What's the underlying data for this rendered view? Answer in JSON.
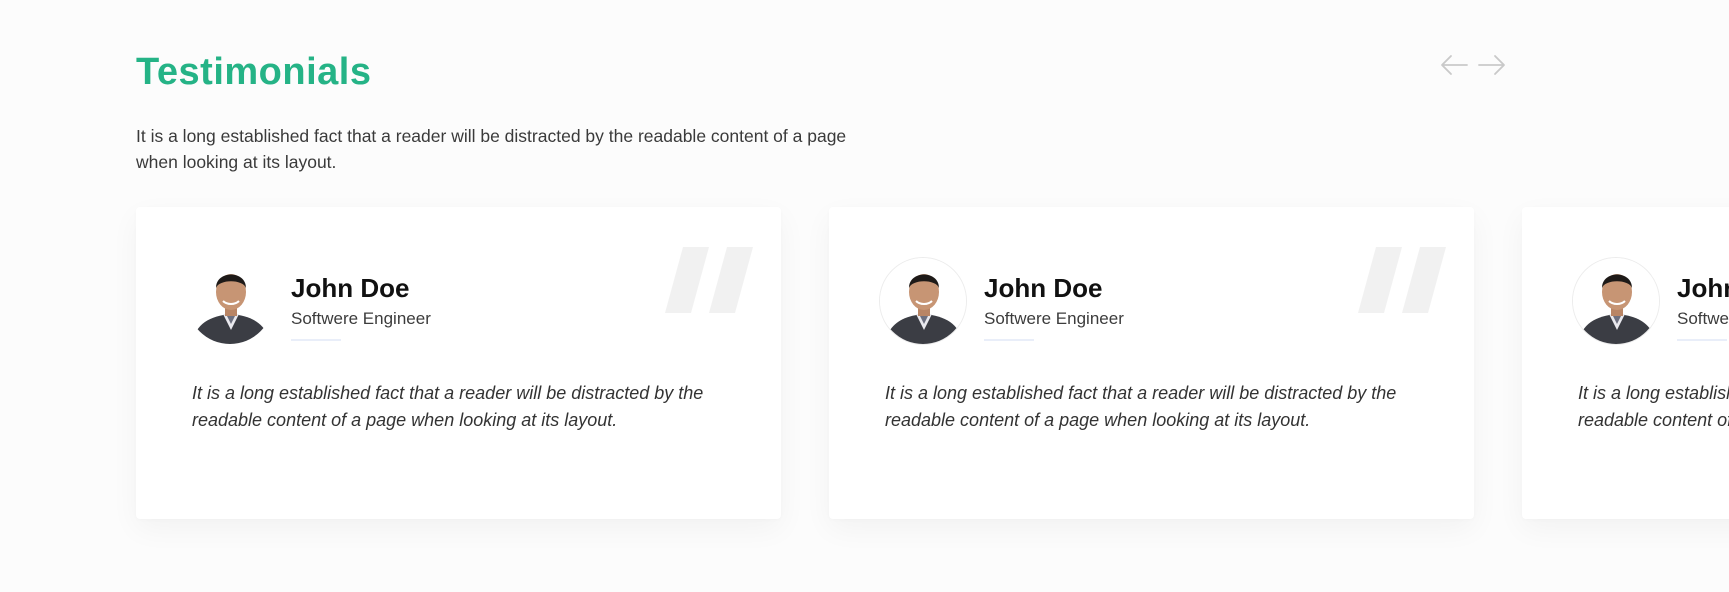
{
  "header": {
    "title": "Testimonials",
    "intro": "It is a long established fact that a reader will be distracted by the readable content of a page when looking at its layout."
  },
  "nav": {
    "prev_icon": "arrow-left-icon",
    "next_icon": "arrow-right-icon"
  },
  "testimonials": [
    {
      "name": "John Doe",
      "role": "Softwere Engineer",
      "quote": "It is a long established fact that a reader will be distracted by the readable content of a page when looking at its layout.",
      "avatar_icon": "avatar-photo"
    },
    {
      "name": "John Doe",
      "role": "Softwere Engineer",
      "quote": "It is a long established fact that a reader will be distracted by the readable content of a page when looking at its layout.",
      "avatar_icon": "avatar-photo"
    },
    {
      "name": "John Doe",
      "role": "Softwere Engineer",
      "quote": "It is a long established fact that a reader will be distracted by the readable content of a page when looking at its layout.",
      "avatar_icon": "avatar-photo"
    }
  ],
  "colors": {
    "accent": "#25b386",
    "quote_mark": "#f1f1f1",
    "arrow": "#c9c9c9"
  }
}
